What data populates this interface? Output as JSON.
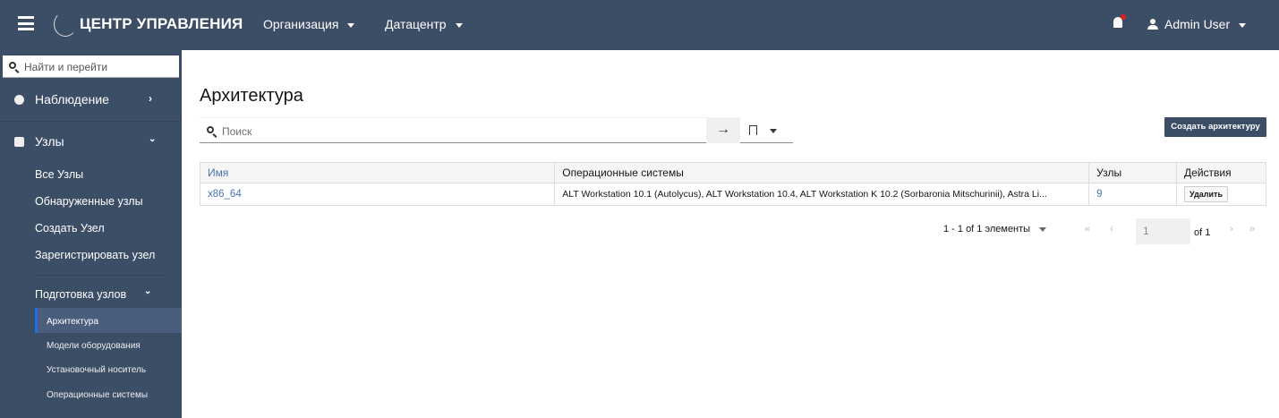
{
  "header": {
    "brand": "ЦЕНТР УПРАВЛЕНИЯ",
    "org_menu": "Организация",
    "dc_menu": "Датацентр",
    "user": "Admin User"
  },
  "sidebar": {
    "search_placeholder": "Найти и перейти",
    "monitoring": "Наблюдение",
    "hosts": "Узлы",
    "hosts_items": [
      "Все Узлы",
      "Обнаруженные узлы",
      "Создать Узел",
      "Зарегистрировать узел"
    ],
    "provisioning": "Подготовка узлов",
    "provisioning_items": [
      "Архитектура",
      "Модели оборудования",
      "Установочный носитель",
      "Операционные системы"
    ]
  },
  "main": {
    "title": "Архитектура",
    "search_placeholder": "Поиск",
    "create_button": "Создать архитектуру",
    "table": {
      "headers": [
        "Имя",
        "Операционные системы",
        "Узлы",
        "Действия"
      ],
      "rows": [
        {
          "name": "x86_64",
          "os": "ALT Workstation 10.1 (Autolycus), ALT Workstation 10.4, ALT Workstation K 10.2 (Sorbaronia Mitschurinii), Astra Li...",
          "hosts": "9",
          "action": "Удалить"
        }
      ]
    },
    "pagination": {
      "summary": "1 - 1 of 1 элементы",
      "page": "1",
      "of": "of 1"
    }
  }
}
